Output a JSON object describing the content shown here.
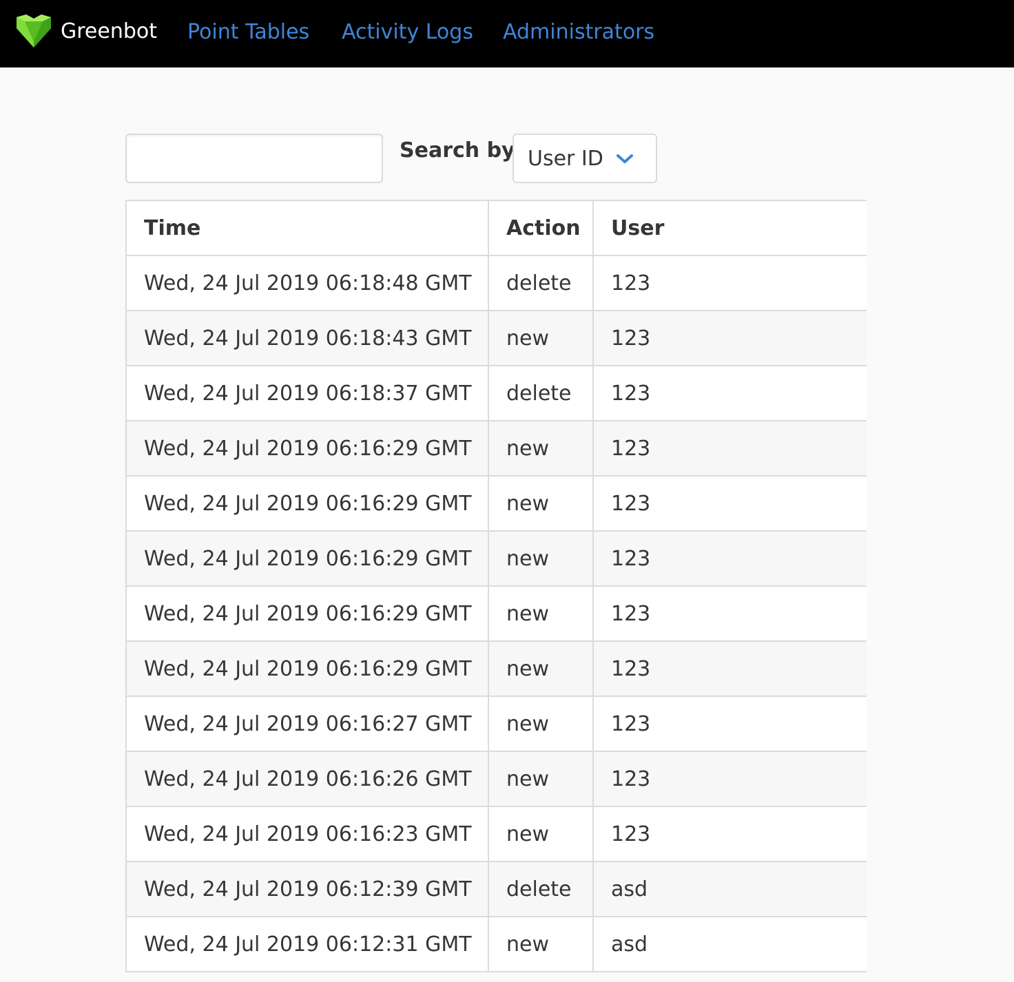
{
  "navbar": {
    "brand": "Greenbot",
    "brand_icon": "green-heart-gem-icon",
    "links": [
      "Point Tables",
      "Activity Logs",
      "Administrators"
    ],
    "link_color": "#3e86d8"
  },
  "search": {
    "value": "",
    "label": "Search by:",
    "select_value": "User ID"
  },
  "table": {
    "headers": [
      "Time",
      "Action",
      "User"
    ],
    "rows": [
      [
        "Wed, 24 Jul 2019 06:18:48 GMT",
        "delete",
        "123"
      ],
      [
        "Wed, 24 Jul 2019 06:18:43 GMT",
        "new",
        "123"
      ],
      [
        "Wed, 24 Jul 2019 06:18:37 GMT",
        "delete",
        "123"
      ],
      [
        "Wed, 24 Jul 2019 06:16:29 GMT",
        "new",
        "123"
      ],
      [
        "Wed, 24 Jul 2019 06:16:29 GMT",
        "new",
        "123"
      ],
      [
        "Wed, 24 Jul 2019 06:16:29 GMT",
        "new",
        "123"
      ],
      [
        "Wed, 24 Jul 2019 06:16:29 GMT",
        "new",
        "123"
      ],
      [
        "Wed, 24 Jul 2019 06:16:29 GMT",
        "new",
        "123"
      ],
      [
        "Wed, 24 Jul 2019 06:16:27 GMT",
        "new",
        "123"
      ],
      [
        "Wed, 24 Jul 2019 06:16:26 GMT",
        "new",
        "123"
      ],
      [
        "Wed, 24 Jul 2019 06:16:23 GMT",
        "new",
        "123"
      ],
      [
        "Wed, 24 Jul 2019 06:12:39 GMT",
        "delete",
        "asd"
      ],
      [
        "Wed, 24 Jul 2019 06:12:31 GMT",
        "new",
        "asd"
      ]
    ]
  }
}
